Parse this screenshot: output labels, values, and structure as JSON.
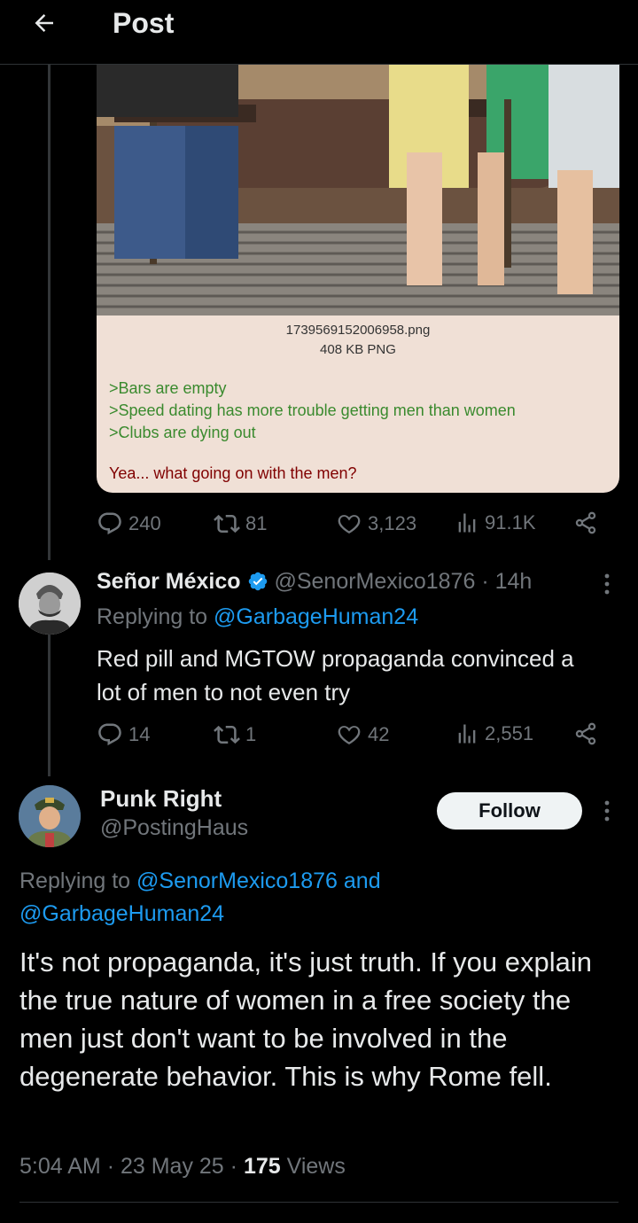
{
  "header": {
    "title": "Post"
  },
  "original_post": {
    "card": {
      "filename": "1739569152006958.png",
      "filesize": "408 KB PNG",
      "greentext": [
        ">Bars are empty",
        ">Speed dating has more trouble getting men than women",
        ">Clubs are dying out"
      ],
      "question": "Yea... what going on with the men?"
    },
    "stats": {
      "replies": "240",
      "reposts": "81",
      "likes": "3,123",
      "views": "91.1K"
    }
  },
  "reply1": {
    "name": "Señor México",
    "handle": "@SenorMexico1876",
    "time": "· 14h",
    "replying_prefix": "Replying to",
    "replying_to": "@GarbageHuman24",
    "text_line1": "Red pill and MGTOW propaganda convinced a",
    "text_line2": "lot of men to not even try",
    "stats": {
      "replies": "14",
      "reposts": "1",
      "likes": "42",
      "views": "2,551"
    }
  },
  "reply2": {
    "name": "Punk Right",
    "handle": "@PostingHaus",
    "follow_label": "Follow",
    "replying_prefix": "Replying to",
    "replying_to_1": "@SenorMexico1876",
    "replying_and": "and",
    "replying_to_2": "@GarbageHuman24",
    "text": "It's not propaganda, it's just truth. If you explain the true nature of women in a free society the men just don't want to be involved in the degenerate behavior. This is why Rome fell.",
    "meta": {
      "time": "5:04 AM",
      "date": "23 May 25",
      "views_count": "175",
      "views_label": "Views"
    }
  },
  "colors": {
    "background": "#000000",
    "text": "#e7e9ea",
    "muted": "#71767b",
    "link": "#1d9bf0",
    "verified": "#1d9bf0"
  },
  "icons": [
    "back-arrow-icon",
    "reply-icon",
    "repost-icon",
    "like-icon",
    "views-icon",
    "share-icon",
    "verified-badge-icon",
    "more-icon"
  ]
}
